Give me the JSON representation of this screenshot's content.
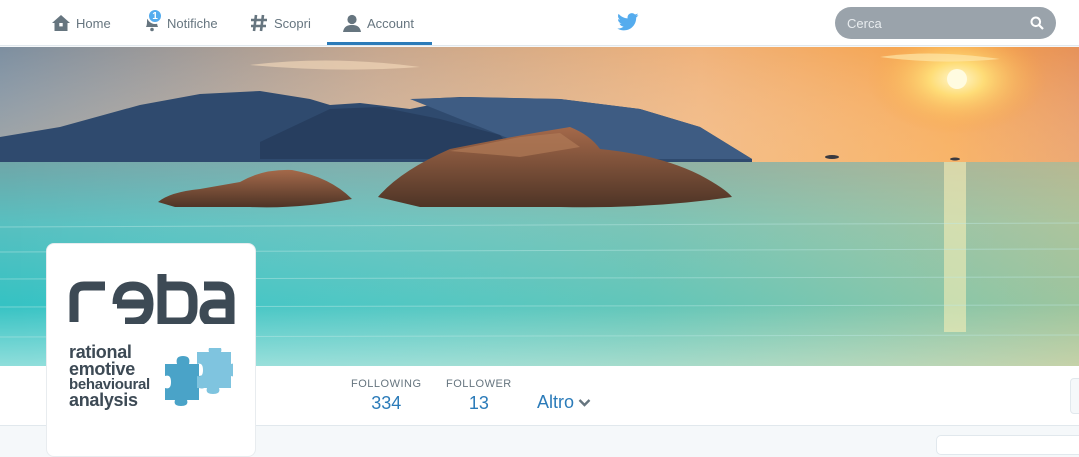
{
  "nav": {
    "items": [
      {
        "label": "Home",
        "icon": "home-icon"
      },
      {
        "label": "Notifiche",
        "icon": "bell-icon",
        "badge": "1"
      },
      {
        "label": "Scopri",
        "icon": "hashtag-icon"
      },
      {
        "label": "Account",
        "icon": "user-icon",
        "active": true
      }
    ],
    "brand_icon": "twitter-bird-icon",
    "search_placeholder": "Cerca"
  },
  "profile": {
    "logo": {
      "wordmark": "reba",
      "tagline_lines": [
        "rational",
        "emotive",
        "behavioural",
        "analysis"
      ]
    },
    "stats": [
      {
        "label": "FOLLOWING",
        "value": "334"
      },
      {
        "label": "FOLLOWER",
        "value": "13"
      }
    ],
    "more_label": "Altro"
  },
  "colors": {
    "accent": "#2b7bb9",
    "twitter_blue": "#55acee",
    "nav_text": "#66757f",
    "logo_dark": "#3d4a55",
    "logo_puzzle": "#4aa3c8"
  }
}
